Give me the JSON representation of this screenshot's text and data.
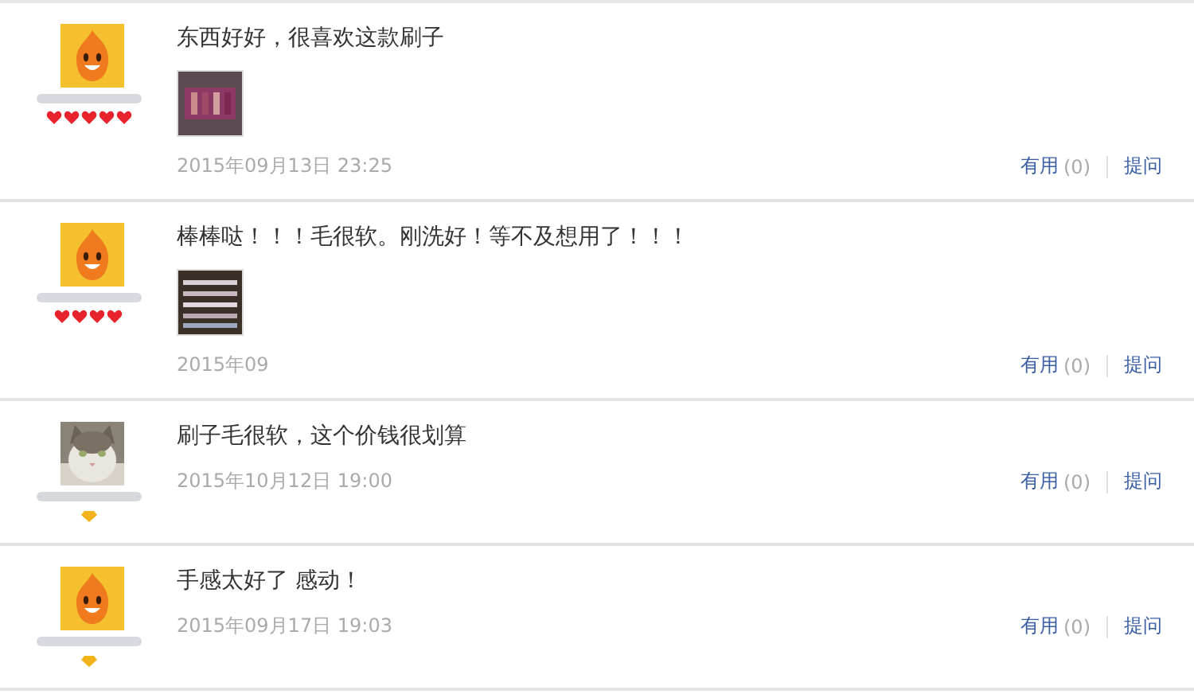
{
  "reviews": [
    {
      "avatar": {
        "kind": "mascot"
      },
      "badge": {
        "kind": "heart",
        "stars": 5
      },
      "text": "东西好好，很喜欢这款刷子",
      "date": "2015年09月13日 23:25",
      "useful": "有用",
      "useful_count": "(0)",
      "ask": "提问"
    },
    {
      "avatar": {
        "kind": "mascot"
      },
      "badge": {
        "kind": "heart",
        "stars": 4
      },
      "text": "棒棒哒！！！毛很软。刚洗好！等不及想用了！！！",
      "date": "2015年09",
      "useful": "有用",
      "useful_count": "(0)",
      "ask": "提问"
    },
    {
      "badge": {
        "kind": "diamond"
      },
      "text": "刷子毛很软，这个价钱很划算",
      "date": "2015年10月12日 19:00",
      "useful": "有用",
      "useful_count": "(0)",
      "ask": "提问"
    },
    {
      "avatar": {
        "kind": "mascot"
      },
      "badge": {
        "kind": "diamond"
      },
      "text": "手感太好了 感动！",
      "date": "2015年09月17日 19:03",
      "useful": "有用",
      "useful_count": "(0)",
      "ask": "提问"
    }
  ]
}
